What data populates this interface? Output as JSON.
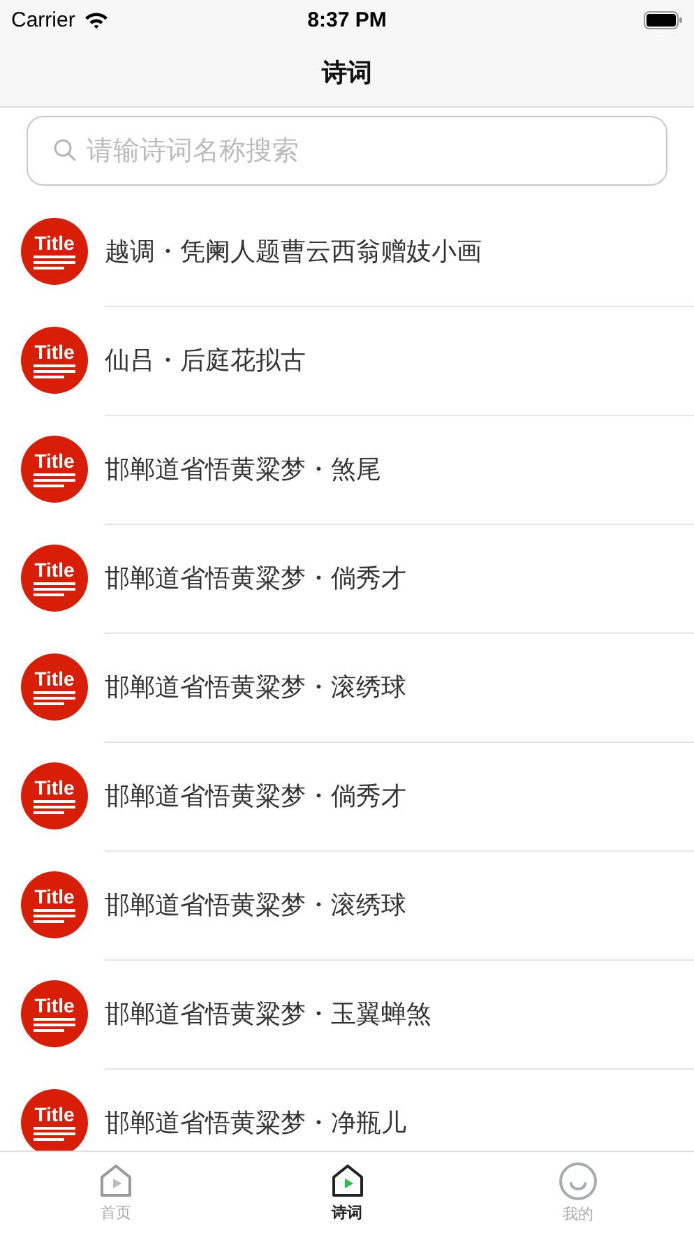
{
  "status_bar": {
    "carrier": "Carrier",
    "time": "8:37 PM"
  },
  "nav": {
    "title": "诗词"
  },
  "search": {
    "placeholder": "请输诗词名称搜索"
  },
  "rows": [
    {
      "badge": "Title",
      "title": "越调・凭阑人题曹云西翁赠妓小画"
    },
    {
      "badge": "Title",
      "title": "仙吕・后庭花拟古"
    },
    {
      "badge": "Title",
      "title": "邯郸道省悟黄粱梦・煞尾"
    },
    {
      "badge": "Title",
      "title": "邯郸道省悟黄粱梦・倘秀才"
    },
    {
      "badge": "Title",
      "title": "邯郸道省悟黄粱梦・滚绣球"
    },
    {
      "badge": "Title",
      "title": "邯郸道省悟黄粱梦・倘秀才"
    },
    {
      "badge": "Title",
      "title": "邯郸道省悟黄粱梦・滚绣球"
    },
    {
      "badge": "Title",
      "title": "邯郸道省悟黄粱梦・玉翼蝉煞"
    },
    {
      "badge": "Title",
      "title": "邯郸道省悟黄粱梦・净瓶儿"
    }
  ],
  "tabs": [
    {
      "label": "首页",
      "kind": "house",
      "selected": false
    },
    {
      "label": "诗词",
      "kind": "house",
      "selected": true
    },
    {
      "label": "我的",
      "kind": "smile",
      "selected": false
    }
  ]
}
